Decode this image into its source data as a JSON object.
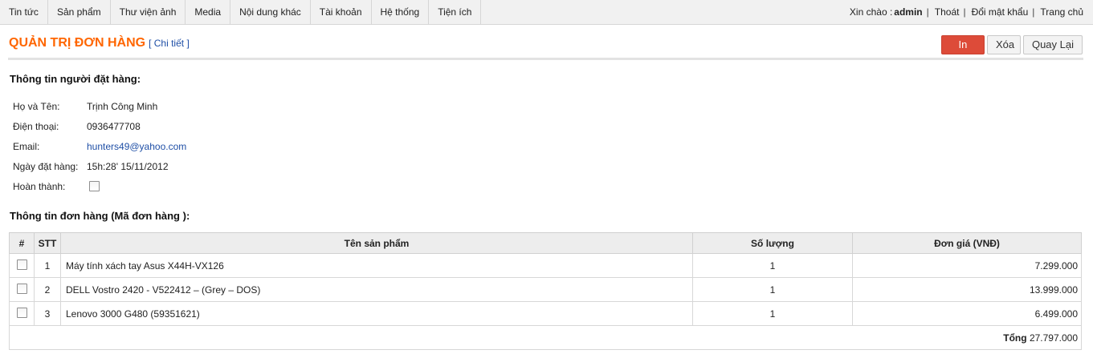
{
  "nav": {
    "items": [
      "Tin tức",
      "Sản phẩm",
      "Thư viện ảnh",
      "Media",
      "Nội dung khác",
      "Tài khoản",
      "Hệ thống",
      "Tiện ích"
    ],
    "greeting": "Xin chào :",
    "username": "admin",
    "logout": "Thoát",
    "change_password": "Đổi mật khẩu",
    "home": "Trang chủ",
    "separator": "|"
  },
  "header": {
    "title": "QUẢN TRỊ ĐƠN HÀNG",
    "subtitle": "[ Chi tiết ]",
    "print_label": "In",
    "delete_label": "Xóa",
    "back_label": "Quay Lại",
    "print_color": "#dd4b39",
    "title_color": "#ff6600"
  },
  "customer": {
    "section_title": "Thông tin người đặt hàng:",
    "name_label": "Họ và Tên:",
    "name": "Trịnh Công Minh",
    "phone_label": "Điện thoại:",
    "phone": "0936477708",
    "email_label": "Email:",
    "email": "hunters49@yahoo.com",
    "date_label": "Ngày đặt hàng:",
    "date": "15h:28' 15/11/2012",
    "done_label": "Hoàn thành:",
    "done_checked": false
  },
  "order": {
    "section_title": "Thông tin đơn hàng (Mã đơn hàng ):",
    "columns": [
      "#",
      "STT",
      "Tên sản phẩm",
      "Số lượng",
      "Đơn giá (VNĐ)"
    ],
    "rows": [
      {
        "stt": "1",
        "name": "Máy tính xách tay Asus X44H-VX126",
        "qty": "1",
        "price": "7.299.000"
      },
      {
        "stt": "2",
        "name": "DELL Vostro 2420 - V522412 – (Grey – DOS)",
        "qty": "1",
        "price": "13.999.000"
      },
      {
        "stt": "3",
        "name": "Lenovo 3000 G480 (59351621)",
        "qty": "1",
        "price": "6.499.000"
      }
    ],
    "total_label": "Tổng",
    "total": "27.797.000"
  }
}
